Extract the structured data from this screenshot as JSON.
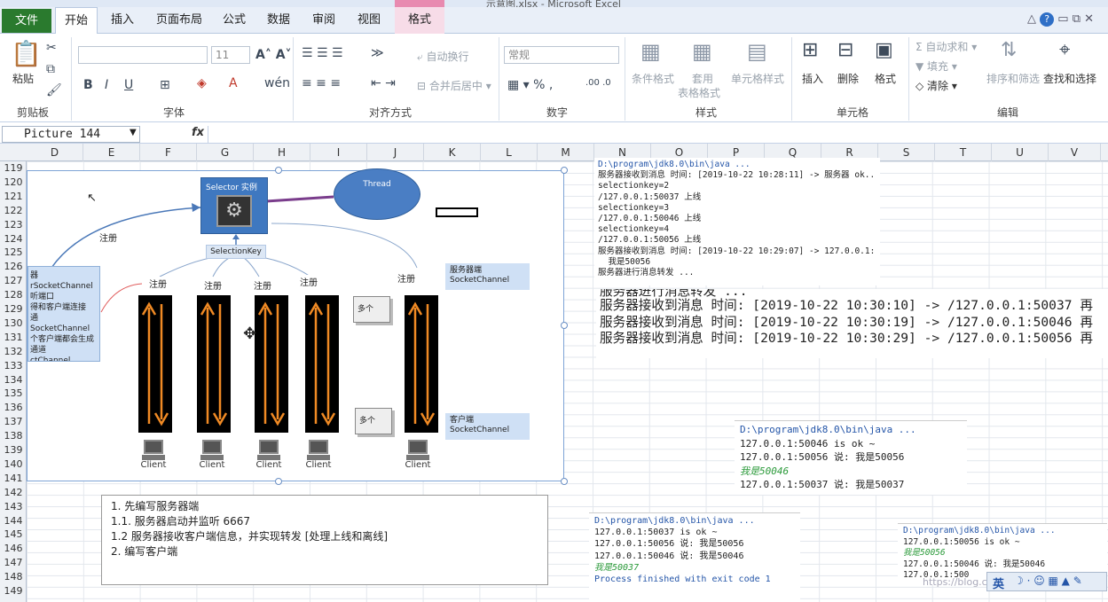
{
  "window": {
    "title": "示意图.xlsx - Microsoft Excel",
    "context_tab": "格式"
  },
  "tabs": [
    "文件",
    "开始",
    "插入",
    "页面布局",
    "公式",
    "数据",
    "审阅",
    "视图",
    "格式"
  ],
  "ribbon": {
    "groups": [
      "剪贴板",
      "字体",
      "对齐方式",
      "数字",
      "样式",
      "单元格",
      "编辑"
    ],
    "paste": "粘贴",
    "font_size": "11",
    "wrap": "自动换行",
    "merge": "合并后居中",
    "number_format": "常规",
    "cond_format": "条件格式",
    "table_fmt1": "套用",
    "table_fmt2": "表格格式",
    "cell_style": "单元格样式",
    "insert": "插入",
    "delete": "删除",
    "format": "格式",
    "autosum": "自动求和",
    "fill": "填充",
    "clear": "清除",
    "sort": "排序和筛选",
    "find": "查找和选择"
  },
  "formula_bar": {
    "name_box": "Picture 144",
    "fx": "fx",
    "value": ""
  },
  "columns": [
    "D",
    "E",
    "F",
    "G",
    "H",
    "I",
    "J",
    "K",
    "L",
    "M",
    "N",
    "O",
    "P",
    "Q",
    "R",
    "S",
    "T",
    "U",
    "V"
  ],
  "rows": [
    "119",
    "120",
    "121",
    "122",
    "123",
    "124",
    "125",
    "126",
    "127",
    "128",
    "129",
    "130",
    "131",
    "132",
    "133",
    "134",
    "135",
    "136",
    "137",
    "138",
    "139",
    "140",
    "141",
    "142",
    "143",
    "144",
    "145",
    "146",
    "147",
    "148",
    "149"
  ],
  "diagram": {
    "selector": "Selector 实例",
    "thread": "Thread",
    "selection_key": "SelectionKey",
    "register": "注册",
    "many": "多个",
    "server_box": [
      "器",
      "rSocketChannel",
      "听端口",
      "得和客户端连接",
      "通 SocketChannel",
      "个客户端都会生成",
      "通道",
      "ctChannel"
    ],
    "server_label": [
      "服务器端",
      "SocketChannel"
    ],
    "client_label": [
      "客户端",
      "SocketChannel"
    ],
    "client": "Client"
  },
  "console_top": [
    "D:\\program\\jdk8.0\\bin\\java ...",
    "服务器接收到消息 时间: [2019-10-22 10:28:11] -> 服务器 ok..",
    "selectionkey=2",
    "/127.0.0.1:50037 上线",
    "selectionkey=3",
    "/127.0.0.1:50046 上线",
    "selectionkey=4",
    "/127.0.0.1:50056 上线",
    "服务器接收到消息 时间: [2019-10-22 10:29:07] -> 127.0.0.1:",
    "  我是50056",
    "",
    "服务器进行消息转发 ..."
  ],
  "console_big": [
    "服务器进行消息转发 ...",
    "服务器接收到消息 时间: [2019-10-22 10:30:10] -> /127.0.0.1:50037 再",
    "服务器接收到消息 时间: [2019-10-22 10:30:19] -> /127.0.0.1:50046 再",
    "服务器接收到消息 时间: [2019-10-22 10:30:29] -> /127.0.0.1:50056 再"
  ],
  "console_mid": [
    "D:\\program\\jdk8.0\\bin\\java ...",
    "127.0.0.1:50046 is ok ~",
    "127.0.0.1:50056 说: 我是50056",
    "我是50046",
    "127.0.0.1:50037 说: 我是50037"
  ],
  "console_bl": [
    "D:\\program\\jdk8.0\\bin\\java ...",
    "127.0.0.1:50037 is ok ~",
    "127.0.0.1:50056 说: 我是50056",
    "127.0.0.1:50046 说: 我是50046",
    "我是50037",
    "",
    "Process finished with exit code 1"
  ],
  "console_br": [
    "D:\\program\\jdk8.0\\bin\\java ...",
    "127.0.0.1:50056 is ok ~",
    "我是50056",
    "127.0.0.1:50046 说: 我是50046",
    "127.0.0.1:500"
  ],
  "notes": [
    "1. 先编写服务器端",
    "1.1. 服务器启动并监听 6667",
    "1.2  服务器接收客户端信息，并实现转发 [处理上线和离线]",
    "2. 编写客户端"
  ],
  "watermark": "https://blog.csdn.net/weixin_42",
  "ime": "英",
  "colors": {
    "file_tab": "#2a7a2e",
    "selector": "#3f78c0",
    "thread": "#4a7ec4",
    "arrow": "#f08a24"
  }
}
